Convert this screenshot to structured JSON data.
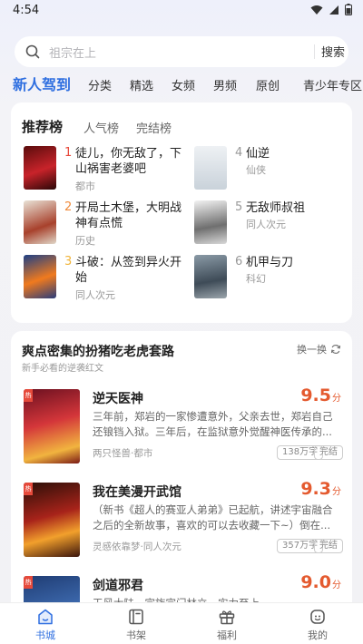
{
  "status": {
    "time": "4:54"
  },
  "search": {
    "placeholder": "祖宗在上",
    "button": "搜索"
  },
  "tabs": [
    {
      "label": "新人驾到",
      "active": true
    },
    {
      "label": "分类"
    },
    {
      "label": "精选"
    },
    {
      "label": "女频"
    },
    {
      "label": "男频"
    },
    {
      "label": "原创"
    },
    {
      "label": "青少年专区"
    }
  ],
  "ranking": {
    "tabs": [
      "推荐榜",
      "人气榜",
      "完结榜"
    ],
    "items": [
      {
        "rank": "1",
        "title": "徒儿，你无敌了，下山祸害老婆吧",
        "tag": "都市",
        "rank_color": "#e8483b"
      },
      {
        "rank": "2",
        "title": "开局土木堡，大明战神有点慌",
        "tag": "历史",
        "rank_color": "#f08a3a"
      },
      {
        "rank": "3",
        "title": "斗破：从签到异火开始",
        "tag": "同人次元",
        "rank_color": "#f0b43a"
      },
      {
        "rank": "4",
        "title": "仙逆",
        "tag": "仙侠",
        "rank_color": "#999999"
      },
      {
        "rank": "5",
        "title": "无敌师叔祖",
        "tag": "同人次元",
        "rank_color": "#999999"
      },
      {
        "rank": "6",
        "title": "机甲与刀",
        "tag": "科幻",
        "rank_color": "#999999"
      }
    ]
  },
  "list": {
    "title": "爽点密集的扮猪吃老虎套路",
    "subtitle": "新手必看的逆袭红文",
    "refresh": "换一换",
    "books": [
      {
        "title": "逆天医神",
        "score": "9.5",
        "unit": "分",
        "desc": "三年前，郑岩的一家惨遭意外，父亲去世，郑岩自己还锒铛入狱。三年后，在监狱意外觉醒神医传承的...",
        "meta": "两只怪兽·都市",
        "words": "138万字",
        "status": "完结",
        "badge": "热"
      },
      {
        "title": "我在美漫开武馆",
        "score": "9.3",
        "unit": "分",
        "desc": "（新书《超人的赛亚人弟弟》已起航，讲述宇宙融合之后的全新故事，喜欢的可以去收藏一下~）倒在...",
        "meta": "灵感依靠梦·同人次元",
        "words": "357万字",
        "status": "完结",
        "badge": "热"
      },
      {
        "title": "剑道邪君",
        "score": "9.0",
        "unit": "分",
        "desc": "天风大陆，宗族宗门林立，实力至上。",
        "meta": "",
        "words": "",
        "status": "",
        "badge": "热"
      }
    ]
  },
  "nav": [
    {
      "label": "书城",
      "icon": "bookstore-icon",
      "active": true
    },
    {
      "label": "书架",
      "icon": "bookshelf-icon"
    },
    {
      "label": "福利",
      "icon": "gift-icon"
    },
    {
      "label": "我的",
      "icon": "profile-icon"
    }
  ],
  "colors": {
    "accent": "#2f6fe0",
    "score": "#e45a2f"
  }
}
